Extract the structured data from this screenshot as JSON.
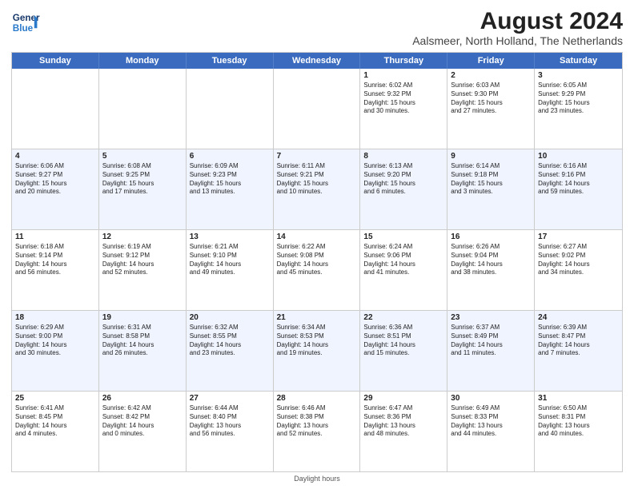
{
  "header": {
    "logo_line1": "General",
    "logo_line2": "Blue",
    "month_year": "August 2024",
    "location": "Aalsmeer, North Holland, The Netherlands"
  },
  "days_of_week": [
    "Sunday",
    "Monday",
    "Tuesday",
    "Wednesday",
    "Thursday",
    "Friday",
    "Saturday"
  ],
  "weeks": [
    [
      {
        "day": "",
        "text": ""
      },
      {
        "day": "",
        "text": ""
      },
      {
        "day": "",
        "text": ""
      },
      {
        "day": "",
        "text": ""
      },
      {
        "day": "1",
        "text": "Sunrise: 6:02 AM\nSunset: 9:32 PM\nDaylight: 15 hours\nand 30 minutes."
      },
      {
        "day": "2",
        "text": "Sunrise: 6:03 AM\nSunset: 9:30 PM\nDaylight: 15 hours\nand 27 minutes."
      },
      {
        "day": "3",
        "text": "Sunrise: 6:05 AM\nSunset: 9:29 PM\nDaylight: 15 hours\nand 23 minutes."
      }
    ],
    [
      {
        "day": "4",
        "text": "Sunrise: 6:06 AM\nSunset: 9:27 PM\nDaylight: 15 hours\nand 20 minutes."
      },
      {
        "day": "5",
        "text": "Sunrise: 6:08 AM\nSunset: 9:25 PM\nDaylight: 15 hours\nand 17 minutes."
      },
      {
        "day": "6",
        "text": "Sunrise: 6:09 AM\nSunset: 9:23 PM\nDaylight: 15 hours\nand 13 minutes."
      },
      {
        "day": "7",
        "text": "Sunrise: 6:11 AM\nSunset: 9:21 PM\nDaylight: 15 hours\nand 10 minutes."
      },
      {
        "day": "8",
        "text": "Sunrise: 6:13 AM\nSunset: 9:20 PM\nDaylight: 15 hours\nand 6 minutes."
      },
      {
        "day": "9",
        "text": "Sunrise: 6:14 AM\nSunset: 9:18 PM\nDaylight: 15 hours\nand 3 minutes."
      },
      {
        "day": "10",
        "text": "Sunrise: 6:16 AM\nSunset: 9:16 PM\nDaylight: 14 hours\nand 59 minutes."
      }
    ],
    [
      {
        "day": "11",
        "text": "Sunrise: 6:18 AM\nSunset: 9:14 PM\nDaylight: 14 hours\nand 56 minutes."
      },
      {
        "day": "12",
        "text": "Sunrise: 6:19 AM\nSunset: 9:12 PM\nDaylight: 14 hours\nand 52 minutes."
      },
      {
        "day": "13",
        "text": "Sunrise: 6:21 AM\nSunset: 9:10 PM\nDaylight: 14 hours\nand 49 minutes."
      },
      {
        "day": "14",
        "text": "Sunrise: 6:22 AM\nSunset: 9:08 PM\nDaylight: 14 hours\nand 45 minutes."
      },
      {
        "day": "15",
        "text": "Sunrise: 6:24 AM\nSunset: 9:06 PM\nDaylight: 14 hours\nand 41 minutes."
      },
      {
        "day": "16",
        "text": "Sunrise: 6:26 AM\nSunset: 9:04 PM\nDaylight: 14 hours\nand 38 minutes."
      },
      {
        "day": "17",
        "text": "Sunrise: 6:27 AM\nSunset: 9:02 PM\nDaylight: 14 hours\nand 34 minutes."
      }
    ],
    [
      {
        "day": "18",
        "text": "Sunrise: 6:29 AM\nSunset: 9:00 PM\nDaylight: 14 hours\nand 30 minutes."
      },
      {
        "day": "19",
        "text": "Sunrise: 6:31 AM\nSunset: 8:58 PM\nDaylight: 14 hours\nand 26 minutes."
      },
      {
        "day": "20",
        "text": "Sunrise: 6:32 AM\nSunset: 8:55 PM\nDaylight: 14 hours\nand 23 minutes."
      },
      {
        "day": "21",
        "text": "Sunrise: 6:34 AM\nSunset: 8:53 PM\nDaylight: 14 hours\nand 19 minutes."
      },
      {
        "day": "22",
        "text": "Sunrise: 6:36 AM\nSunset: 8:51 PM\nDaylight: 14 hours\nand 15 minutes."
      },
      {
        "day": "23",
        "text": "Sunrise: 6:37 AM\nSunset: 8:49 PM\nDaylight: 14 hours\nand 11 minutes."
      },
      {
        "day": "24",
        "text": "Sunrise: 6:39 AM\nSunset: 8:47 PM\nDaylight: 14 hours\nand 7 minutes."
      }
    ],
    [
      {
        "day": "25",
        "text": "Sunrise: 6:41 AM\nSunset: 8:45 PM\nDaylight: 14 hours\nand 4 minutes."
      },
      {
        "day": "26",
        "text": "Sunrise: 6:42 AM\nSunset: 8:42 PM\nDaylight: 14 hours\nand 0 minutes."
      },
      {
        "day": "27",
        "text": "Sunrise: 6:44 AM\nSunset: 8:40 PM\nDaylight: 13 hours\nand 56 minutes."
      },
      {
        "day": "28",
        "text": "Sunrise: 6:46 AM\nSunset: 8:38 PM\nDaylight: 13 hours\nand 52 minutes."
      },
      {
        "day": "29",
        "text": "Sunrise: 6:47 AM\nSunset: 8:36 PM\nDaylight: 13 hours\nand 48 minutes."
      },
      {
        "day": "30",
        "text": "Sunrise: 6:49 AM\nSunset: 8:33 PM\nDaylight: 13 hours\nand 44 minutes."
      },
      {
        "day": "31",
        "text": "Sunrise: 6:50 AM\nSunset: 8:31 PM\nDaylight: 13 hours\nand 40 minutes."
      }
    ]
  ],
  "footer": "Daylight hours"
}
